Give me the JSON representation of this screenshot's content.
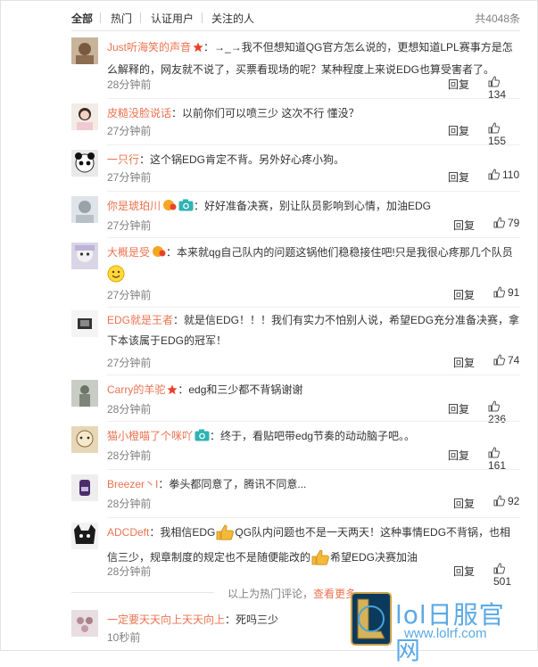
{
  "tabs": {
    "all": "全部",
    "hot": "热门",
    "verified": "认证用户",
    "following": "关注的人",
    "total": "共4048条"
  },
  "actions": {
    "reply": "回复"
  },
  "comments": [
    {
      "user": "Just听海笑的声音",
      "text": "：→_→我不但想知道QG官方怎么说的，更想知道LPL赛事方是怎么解释的，网友就不说了，买票看现场的呢？某种程度上来说EDG也算受害者了。",
      "time": "28分钟前",
      "likes": "134"
    },
    {
      "user": "皮糙没脸说话",
      "text": "：以前你们可以喷三少 这次不行 懂没？",
      "time": "27分钟前",
      "likes": "155"
    },
    {
      "user": "一只行",
      "text": "：这个锅EDG肯定不背。另外好心疼小狗。",
      "time": "27分钟前",
      "likes": "110"
    },
    {
      "user": "你是琥珀川",
      "text": "：好好准备决赛，别让队员影响到心情，加油EDG",
      "time": "27分钟前",
      "likes": "79"
    },
    {
      "user": "大概是受",
      "text": "：本来就qg自己队内的问题这锅他们稳稳接住吧!只是我很心疼那几个队员",
      "time": "27分钟前",
      "likes": "91"
    },
    {
      "user": "EDG就是王者",
      "text": "：就是信EDG！！！我们有实力不怕别人说，希望EDG充分准备决赛，拿下本该属于EDG的冠军！",
      "time": "27分钟前",
      "likes": "74"
    },
    {
      "user": "Carry的羊驼",
      "text": "：edg和三少都不背锅谢谢",
      "time": "28分钟前",
      "likes": "236"
    },
    {
      "user": "猫小橙喵了个咪吖",
      "text": "：终于，看贴吧带edg节奏的动动脑子吧。。",
      "time": "28分钟前",
      "likes": "161"
    },
    {
      "user": "Breezer丶I",
      "text": "：拳头都同意了，腾讯不同意...",
      "time": "28分钟前",
      "likes": "92"
    },
    {
      "user": "ADCDeft",
      "text_a": "：我相信EDG",
      "text_b": "QG队内问题也不是一天两天！这种事情EDG不背锅，也相信三少，规章制度的规定也不是随便能改的",
      "text_c": "希望EDG决赛加油",
      "time": "28分钟前",
      "likes": "501"
    },
    {
      "user": "一定要天天向上天天向上",
      "text": "：死吗三少",
      "time": "10秒前"
    }
  ],
  "footer": {
    "note": "以上为热门评论，",
    "more": "查看更多"
  },
  "watermark": {
    "title": "lol日服官网",
    "url": "www.lolrf.com"
  },
  "colors": {
    "username": "#eb7350",
    "muted": "#808080",
    "watermark": "#5aa9e6"
  }
}
